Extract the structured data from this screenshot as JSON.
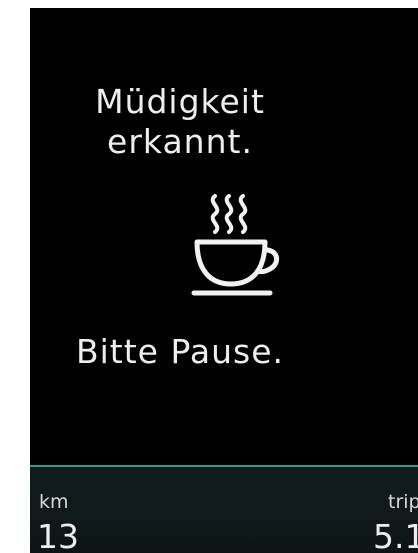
{
  "message": {
    "line1": "Müdigkeit",
    "line2": "erkannt.",
    "pause": "Bitte Pause."
  },
  "icon": "coffee-cup-steam-icon",
  "footer": {
    "left_label": "km",
    "left_value": "13",
    "right_label": "trip",
    "right_value": "5.1"
  },
  "colors": {
    "background": "#000000",
    "text": "#eeeeee",
    "accent_line": "#2aa08a"
  }
}
